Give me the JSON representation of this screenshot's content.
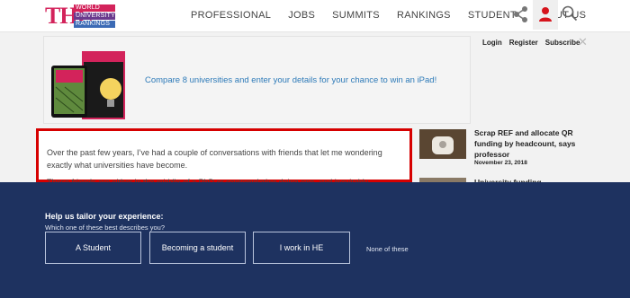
{
  "logo": {
    "the": "THE",
    "line1": "WORLD",
    "line2": "UNIVERSITY",
    "line3": "RANKINGS"
  },
  "nav": {
    "items": [
      "PROFESSIONAL",
      "JOBS",
      "SUMMITS",
      "RANKINGS",
      "STUDENT",
      "ABOUT US"
    ]
  },
  "header_icons": [
    "share-icon",
    "user-icon",
    "search-icon"
  ],
  "colors": {
    "brand": "#d3235b",
    "survey_bg": "#1e3260",
    "link": "#2d7ab8",
    "highlight_border": "#d60000"
  },
  "promo": {
    "text": "Compare 8 universities and enter your details for your chance to win an iPad!"
  },
  "account": {
    "login": "Login",
    "register": "Register",
    "subscribe": "Subscribe",
    "close": "✕"
  },
  "article": {
    "p1_line1": "Over the past few years, I’ve had a couple of conversations with friends that let me wondering",
    "p1_line2": "exactly what universities have become.",
    "p2": "These friends are either in the middle of a PhD or contemplating doing one, and inevitably"
  },
  "sidebar": {
    "card1_title": "Scrap REF and allocate QR funding by headcount, says professor",
    "card1_date": "November 23, 2018",
    "card2_title": "University funding"
  },
  "survey": {
    "title": "Help us tailor your experience:",
    "subtitle": "Which one of these best describes you?",
    "options": [
      "A Student",
      "Becoming a student",
      "I work in HE"
    ],
    "none_label": "None of these"
  }
}
